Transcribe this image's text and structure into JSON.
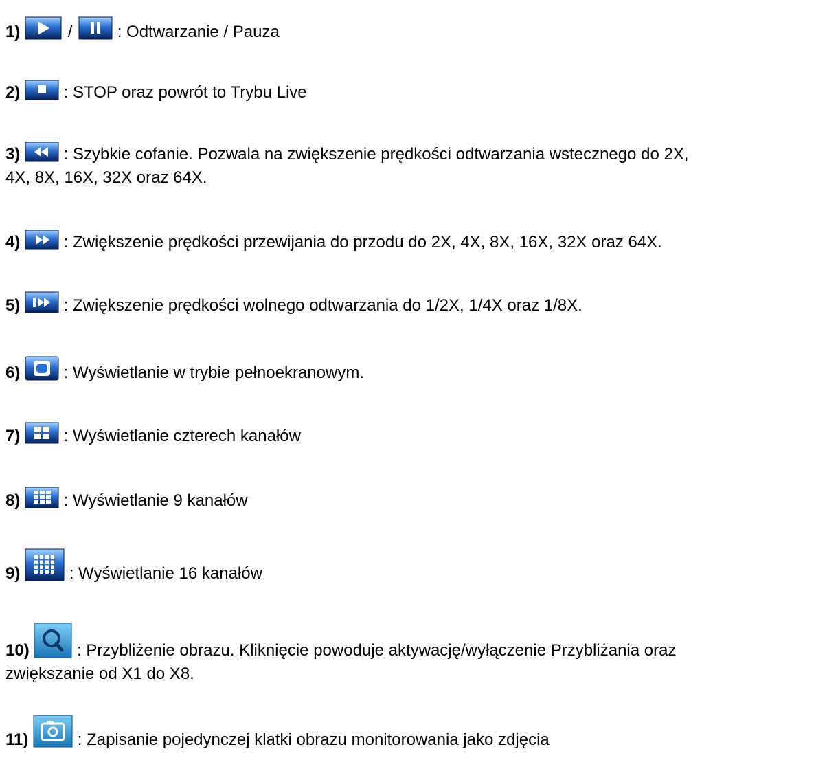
{
  "items": [
    {
      "num": "1)",
      "sep": "/",
      "text": ": Odtwarzanie / Pauza",
      "icons": [
        "play-icon",
        "pause-icon"
      ]
    },
    {
      "num": "2)",
      "text": ": STOP oraz powrót to Trybu Live",
      "icons": [
        "stop-icon"
      ]
    },
    {
      "num": "3)",
      "text": ": Szybkie cofanie. Pozwala na zwiększenie prędkości odtwarzania wstecznego do 2X,",
      "text2": "4X, 8X, 16X, 32X oraz 64X.",
      "icons": [
        "rewind-icon"
      ]
    },
    {
      "num": "4)",
      "text": ": Zwiększenie prędkości przewijania do przodu do 2X, 4X, 8X, 16X, 32X oraz 64X.",
      "icons": [
        "fast-forward-icon"
      ]
    },
    {
      "num": "5)",
      "text": ": Zwiększenie prędkości wolnego odtwarzania do 1/2X, 1/4X oraz 1/8X.",
      "icons": [
        "slow-play-icon"
      ]
    },
    {
      "num": "6)",
      "text": ": Wyświetlanie w trybie pełnoekranowym.",
      "icons": [
        "fullscreen-icon"
      ]
    },
    {
      "num": "7)",
      "text": ": Wyświetlanie czterech kanałów",
      "icons": [
        "quad-view-icon"
      ]
    },
    {
      "num": "8)",
      "text": ": Wyświetlanie 9 kanałów",
      "icons": [
        "nine-view-icon"
      ]
    },
    {
      "num": "9)",
      "text": ": Wyświetlanie 16 kanałów",
      "icons": [
        "sixteen-view-icon"
      ]
    },
    {
      "num": "10)",
      "text": ": Przybliżenie obrazu. Kliknięcie powoduje aktywację/wyłączenie Przybliżania oraz",
      "text2": "zwiększanie od X1 do X8.",
      "icons": [
        "zoom-icon"
      ]
    },
    {
      "num": "11)",
      "text": ": Zapisanie pojedynczej klatki obrazu monitorowania jako zdjęcia",
      "icons": [
        "snapshot-icon"
      ]
    }
  ],
  "colors": {
    "icon_dark": "#0a2a6b",
    "icon_mid": "#1f5fc4",
    "icon_light": "#8fc3ff",
    "zoom_bg": "#2b9ad8"
  }
}
